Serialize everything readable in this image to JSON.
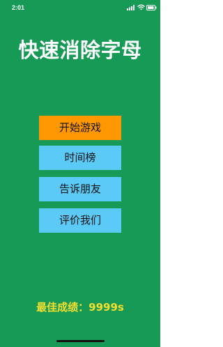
{
  "status_bar": {
    "time": "2:01",
    "icons": [
      "signal-icon",
      "wifi-icon",
      "battery-icon"
    ]
  },
  "app": {
    "title": "快速消除字母"
  },
  "menu": {
    "start_game": "开始游戏",
    "time_rank": "时间榜",
    "tell_friends": "告诉朋友",
    "rate_us": "评价我们"
  },
  "score": {
    "best_label": "最佳成绩：",
    "best_value": "9999s"
  },
  "colors": {
    "background": "#169a56",
    "primary_button": "#ff9800",
    "secondary_button": "#5ccaf7",
    "score_text": "#f4df2e",
    "title_text": "#ffffff"
  }
}
